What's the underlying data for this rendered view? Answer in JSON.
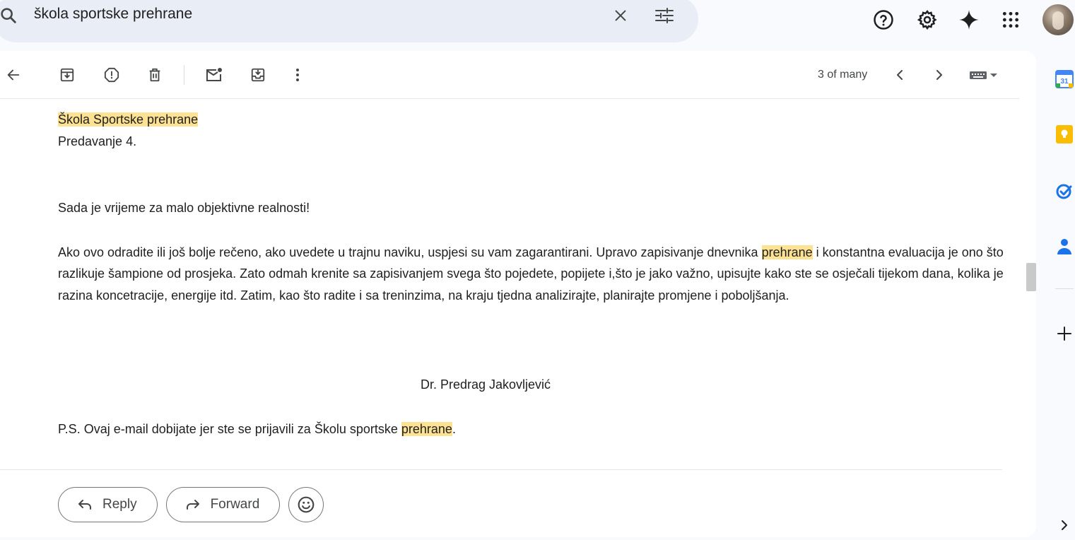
{
  "search": {
    "query": "škola sportske prehrane",
    "icon": "search-icon",
    "clear_icon": "close-icon",
    "options_icon": "tune-icon"
  },
  "header_icons": [
    "help-icon",
    "settings-icon",
    "gemini-icon",
    "apps-icon",
    "avatar"
  ],
  "toolbar": {
    "icons": [
      "back-arrow-icon",
      "archive-icon",
      "report-spam-icon",
      "delete-icon",
      "mark-unread-icon",
      "move-to-icon",
      "more-vert-icon"
    ],
    "pager_text": "3 of many",
    "nav_icons": [
      "chevron-left-icon",
      "chevron-right-icon",
      "keyboard-icon"
    ]
  },
  "message": {
    "title_highlight": "Škola Sportske prehrane",
    "subtitle": "Predavanje 4.",
    "para1": "Sada je vrijeme za malo objektivne realnosti!",
    "para2_a": "Ako ovo odradite ili još bolje rečeno, ako uvedete u trajnu naviku, uspjesi su vam zagarantirani. Upravo zapisivanje dnevnika ",
    "para2_highlight": "prehrane",
    "para2_b": " i konstantna evaluacija  je ono što razlikuje šampione od prosjeka. Zato odmah krenite sa zapisivanjem svega što pojedete, popijete i,što je jako važno, upisujte kako ste se osječali tijekom dana, kolika je razina koncetracije, energije itd. Zatim, kao što radite i sa treninzima, na kraju tjedna analizirajte, planirajte promjene i poboljšanja.",
    "signature": "Dr. Predrag Jakovljević",
    "ps_a": "P.S. Ovaj e-mail dobijate jer ste se prijavili za Školu sportske ",
    "ps_highlight": "prehrane",
    "ps_b": "."
  },
  "actions": {
    "reply_label": "Reply",
    "forward_label": "Forward",
    "emoji_icon": "emoji-icon"
  },
  "side_panel": {
    "calendar_day": "31",
    "icons": [
      "calendar-icon",
      "keep-icon",
      "tasks-icon",
      "contacts-icon",
      "add-icon",
      "chevron-right-icon"
    ]
  },
  "colors": {
    "highlight": "#fde293",
    "background": "#f8fafd",
    "search_bg": "#e9eef6"
  }
}
